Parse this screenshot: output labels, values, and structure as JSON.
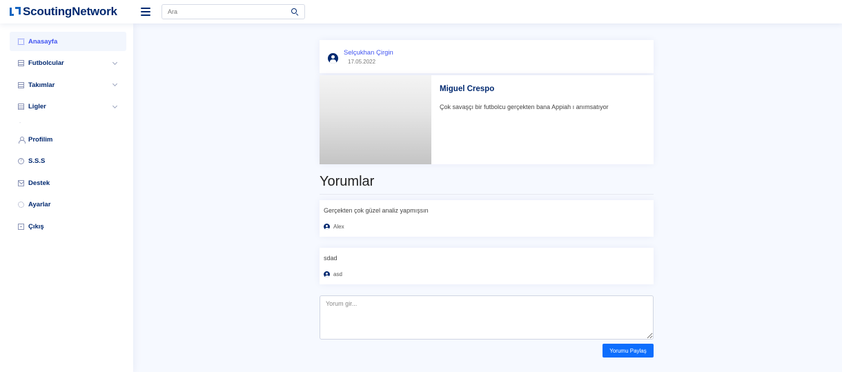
{
  "app": {
    "name": "ScoutingNetwork"
  },
  "search": {
    "placeholder": "Ara"
  },
  "sidebar": {
    "items": [
      {
        "label": "Anasayfa",
        "icon": "grid-icon",
        "active": true
      },
      {
        "label": "Futbolcular",
        "icon": "table-icon",
        "expandable": true
      },
      {
        "label": "Takımlar",
        "icon": "table-icon",
        "expandable": true
      },
      {
        "label": "Ligler",
        "icon": "table-icon",
        "expandable": true
      }
    ],
    "divider_mark": "-",
    "items2": [
      {
        "label": "Profilim",
        "icon": "person-icon"
      },
      {
        "label": "S.S.S",
        "icon": "question-icon"
      },
      {
        "label": "Destek",
        "icon": "envelope-icon"
      },
      {
        "label": "Ayarlar",
        "icon": "gear-icon"
      },
      {
        "label": "Çıkış",
        "icon": "exit-icon"
      }
    ]
  },
  "post": {
    "author": "Selçukhan Çirgin",
    "date": "17.05.2022",
    "player_name": "Miguel Crespo",
    "text": "Çok savaşçı bir futbolcu gerçekten bana Appiah ı anımsatıyor"
  },
  "comments": {
    "title": "Yorumlar",
    "items": [
      {
        "text": "Gerçekten çok güzel analiz yapmışsın",
        "author": "Alex"
      },
      {
        "text": "sdad",
        "author": "asd"
      }
    ]
  },
  "comment_form": {
    "placeholder": "Yorum gir...",
    "submit_label": "Yorumu Paylaş"
  },
  "colors": {
    "brand": "#012970",
    "accent": "#4154f1",
    "button": "#0d6efd",
    "background": "#f6f9ff"
  }
}
